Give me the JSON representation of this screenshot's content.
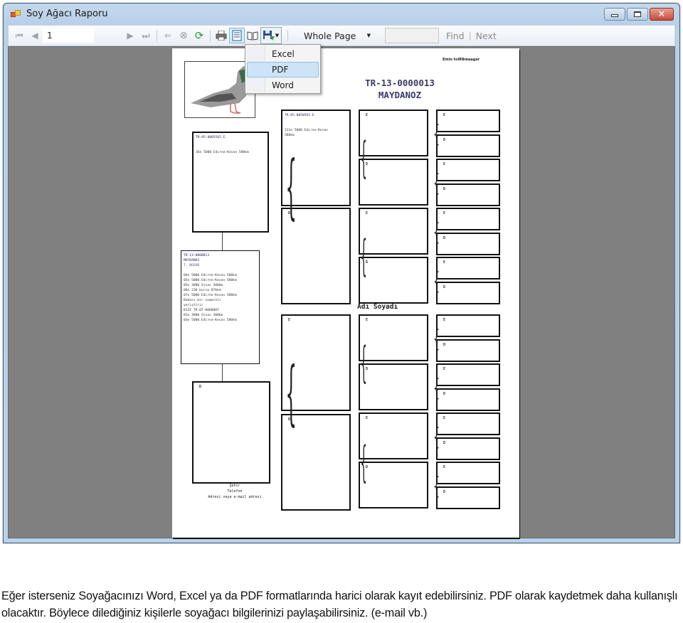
{
  "window": {
    "title": "Soy Ağacı Raporu",
    "controls": [
      "minimize",
      "maximize",
      "close"
    ]
  },
  "toolbar": {
    "first_page_icon": "first-page-icon",
    "prev_page_icon": "prev-page-icon",
    "page_number": "1",
    "page_total": "",
    "next_page_icon": "next-page-icon",
    "last_page_icon": "last-page-icon",
    "back_icon": "back-icon",
    "stop_icon": "stop-icon",
    "refresh_icon": "refresh-icon",
    "print_icon": "print-icon",
    "print_layout_icon": "print-layout-icon",
    "page_setup_icon": "page-setup-icon",
    "export_icon": "save-export-icon",
    "zoom_value": "Whole Page",
    "find_value": "",
    "find_label": "Find",
    "find_separator": "|",
    "next_label": "Next"
  },
  "export_menu": {
    "items": [
      {
        "label": "Excel",
        "highlighted": false
      },
      {
        "label": "PDF",
        "highlighted": true
      },
      {
        "label": "Word",
        "highlighted": false
      }
    ]
  },
  "report": {
    "author": "Emin tolRBmaager",
    "ring_number": "TR-13-0000013",
    "bird_name": "MAYDANOZ",
    "owner_caption": "Adı Soyadı",
    "subject": {
      "lines": [
        "TR-13-0000013",
        "MAYDANOZ",
        "T. BOSUR",
        "",
        "04e 5000 Edirne-Kesan 580km",
        "05e 5000 Edirne-Kesan 580km",
        "05e 3000 Sivas 300km",
        "06e 230 bursa 876km",
        "07e 5000 Edirne-Kesan 580km",
        "Babası bir numaralı",
        "yeriştirir",
        "KIZI TR-07-0000007",
        "01e 3000 Sivas 300km",
        "03e 5000 Edirne-Kesan 580km"
      ]
    },
    "sire": {
      "ring": "TR-05-0005565  E",
      "lines": [
        "36e 5000 Edirne-Kesan 580km"
      ]
    },
    "dam": {
      "label": "D"
    },
    "grand_sire": {
      "ring": "TR-05-0050565  E",
      "lines": [
        "131e 5000 Edirne-Kesan",
        "580km"
      ]
    },
    "gen_labels": {
      "male": "E",
      "female": "D"
    },
    "contact": {
      "city": "Şehir",
      "phone": "Telefon",
      "address": "Adresi veya e-mail adresi"
    }
  },
  "caption": {
    "text": "Eğer isterseniz Soyağacınızı Word, Excel ya da PDF formatlarında harici olarak kayıt edebilirsiniz. PDF olarak kaydetmek daha kullanışlı olacaktır. Böylece dilediğiniz kişilerle soyağacı bilgilerinizi paylaşabilirsiniz. (e-mail vb.)"
  }
}
